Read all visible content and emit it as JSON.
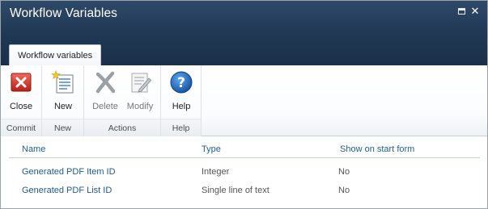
{
  "window": {
    "title": "Workflow Variables"
  },
  "ribbon": {
    "tab_label": "Workflow variables",
    "groups": [
      {
        "name": "Commit",
        "buttons": [
          {
            "label": "Close",
            "icon": "close-icon",
            "enabled": true
          }
        ]
      },
      {
        "name": "New",
        "buttons": [
          {
            "label": "New",
            "icon": "new-item-icon",
            "enabled": true
          }
        ]
      },
      {
        "name": "Actions",
        "buttons": [
          {
            "label": "Delete",
            "icon": "delete-icon",
            "enabled": false
          },
          {
            "label": "Modify",
            "icon": "modify-icon",
            "enabled": false
          }
        ]
      },
      {
        "name": "Help",
        "buttons": [
          {
            "label": "Help",
            "icon": "help-icon",
            "enabled": true
          }
        ]
      }
    ]
  },
  "table": {
    "headers": {
      "name": "Name",
      "type": "Type",
      "show_on_start_form": "Show on start form"
    },
    "rows": [
      {
        "name": "Generated PDF Item ID",
        "type": "Integer",
        "show_on_start_form": "No"
      },
      {
        "name": "Generated PDF List ID",
        "type": "Single line of text",
        "show_on_start_form": "No"
      }
    ]
  },
  "colors": {
    "titlebar": "#223a56",
    "link": "#1e5b8e",
    "close_red": "#d23a2e",
    "help_blue": "#1f6fc0"
  }
}
